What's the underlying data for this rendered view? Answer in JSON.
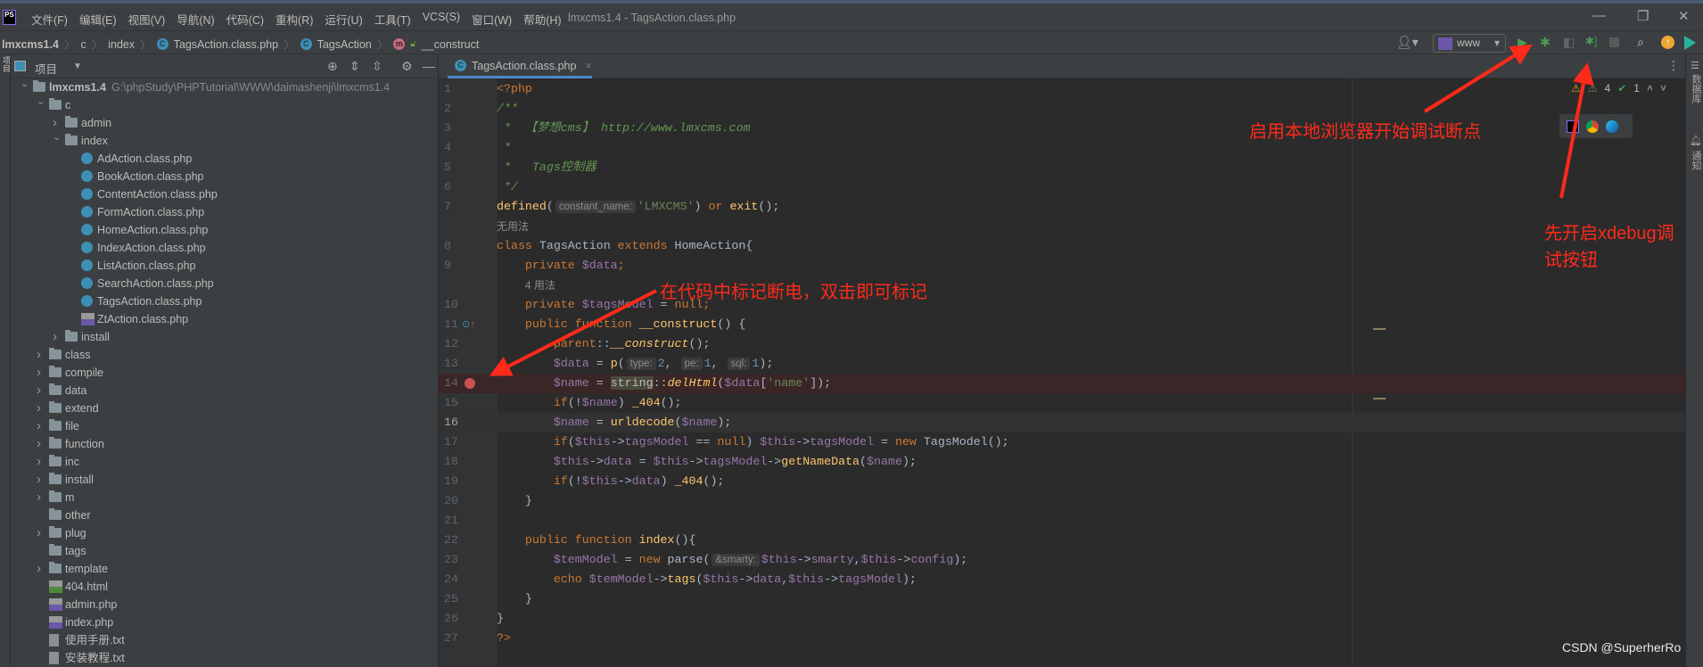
{
  "window": {
    "title": "lmxcms1.4 - TagsAction.class.php",
    "logo": "PS",
    "menu": [
      "文件(F)",
      "编辑(E)",
      "视图(V)",
      "导航(N)",
      "代码(C)",
      "重构(R)",
      "运行(U)",
      "工具(T)",
      "VCS(S)",
      "窗口(W)",
      "帮助(H)"
    ],
    "controls": {
      "minimize": "—",
      "restore": "❐",
      "close": "✕"
    }
  },
  "breadcrumb": [
    "lmxcms1.4",
    "c",
    "index",
    "TagsAction.class.php",
    "TagsAction",
    "__construct"
  ],
  "toolbar": {
    "run_config": "www",
    "icons": [
      "user-icon",
      "run-icon",
      "debug-icon",
      "coverage-icon",
      "listen-debug-connections-icon",
      "stop-icon",
      "search-icon",
      "update-icon",
      "toolbox-icon"
    ]
  },
  "project_panel": {
    "title": "项目",
    "tree": [
      {
        "depth": 0,
        "arrow": "open",
        "type": "folder",
        "label": "lmxcms1.4",
        "path": "G:\\phpStudy\\PHPTutorial\\WWW\\daimashenji\\lmxcms1.4",
        "bold": true
      },
      {
        "depth": 1,
        "arrow": "open",
        "type": "folder",
        "label": "c"
      },
      {
        "depth": 2,
        "arrow": "closed",
        "type": "folder",
        "label": "admin"
      },
      {
        "depth": 2,
        "arrow": "open",
        "type": "folder",
        "label": "index"
      },
      {
        "depth": 3,
        "type": "class",
        "label": "AdAction.class.php"
      },
      {
        "depth": 3,
        "type": "class",
        "label": "BookAction.class.php"
      },
      {
        "depth": 3,
        "type": "class",
        "label": "ContentAction.class.php"
      },
      {
        "depth": 3,
        "type": "class",
        "label": "FormAction.class.php"
      },
      {
        "depth": 3,
        "type": "class",
        "label": "HomeAction.class.php"
      },
      {
        "depth": 3,
        "type": "class",
        "label": "IndexAction.class.php"
      },
      {
        "depth": 3,
        "type": "class",
        "label": "ListAction.class.php"
      },
      {
        "depth": 3,
        "type": "class",
        "label": "SearchAction.class.php"
      },
      {
        "depth": 3,
        "type": "class",
        "label": "TagsAction.class.php"
      },
      {
        "depth": 3,
        "type": "php",
        "label": "ZtAction.class.php"
      },
      {
        "depth": 2,
        "arrow": "closed",
        "type": "folder",
        "label": "install"
      },
      {
        "depth": 1,
        "arrow": "closed",
        "type": "folder",
        "label": "class"
      },
      {
        "depth": 1,
        "arrow": "closed",
        "type": "folder",
        "label": "compile"
      },
      {
        "depth": 1,
        "arrow": "closed",
        "type": "folder",
        "label": "data"
      },
      {
        "depth": 1,
        "arrow": "closed",
        "type": "folder",
        "label": "extend"
      },
      {
        "depth": 1,
        "arrow": "closed",
        "type": "folder",
        "label": "file"
      },
      {
        "depth": 1,
        "arrow": "closed",
        "type": "folder",
        "label": "function"
      },
      {
        "depth": 1,
        "arrow": "closed",
        "type": "folder",
        "label": "inc"
      },
      {
        "depth": 1,
        "arrow": "closed",
        "type": "folder",
        "label": "install"
      },
      {
        "depth": 1,
        "arrow": "closed",
        "type": "folder",
        "label": "m"
      },
      {
        "depth": 1,
        "type": "folder",
        "label": "other"
      },
      {
        "depth": 1,
        "arrow": "closed",
        "type": "folder",
        "label": "plug"
      },
      {
        "depth": 1,
        "type": "folder",
        "label": "tags"
      },
      {
        "depth": 1,
        "arrow": "closed",
        "type": "folder",
        "label": "template"
      },
      {
        "depth": 1,
        "type": "html",
        "label": "404.html"
      },
      {
        "depth": 1,
        "type": "php",
        "label": "admin.php"
      },
      {
        "depth": 1,
        "type": "php",
        "label": "index.php"
      },
      {
        "depth": 1,
        "type": "txt",
        "label": "使用手册.txt"
      },
      {
        "depth": 1,
        "type": "txt",
        "label": "安装教程.txt"
      }
    ]
  },
  "editor": {
    "tab_label": "TagsAction.class.php",
    "inspections": {
      "warnings": "4",
      "ok": "1"
    },
    "breakpoint_line": 14,
    "current_line": 16,
    "lines": [
      {
        "num": "1",
        "t": [
          [
            "k",
            "<?php"
          ]
        ]
      },
      {
        "num": "2",
        "t": [
          [
            "c",
            "/**"
          ]
        ]
      },
      {
        "num": "3",
        "t": [
          [
            "c",
            " *  【梦想cms】 http://www.lmxcms.com"
          ]
        ]
      },
      {
        "num": "4",
        "t": [
          [
            "c",
            " *"
          ]
        ]
      },
      {
        "num": "5",
        "t": [
          [
            "c",
            " *   Tags控制器"
          ]
        ]
      },
      {
        "num": "6",
        "t": [
          [
            "c",
            " */"
          ]
        ]
      },
      {
        "num": "7",
        "t": [
          [
            "f",
            "defined"
          ],
          [
            "p",
            "("
          ],
          [
            "h",
            "constant_name:"
          ],
          [
            "s",
            "'LMXCMS'"
          ],
          [
            "p",
            ") "
          ],
          [
            "k",
            "or "
          ],
          [
            "f",
            "exit"
          ],
          [
            "p",
            "();"
          ]
        ]
      },
      {
        "num": "",
        "t": [
          [
            "lens",
            "无用法"
          ]
        ]
      },
      {
        "num": "8",
        "t": [
          [
            "k",
            "class "
          ],
          [
            "p",
            "TagsAction "
          ],
          [
            "k",
            "extends "
          ],
          [
            "p",
            "HomeAction{"
          ]
        ]
      },
      {
        "num": "9",
        "t": [
          [
            "p",
            "    "
          ],
          [
            "k",
            "private "
          ],
          [
            "v",
            "$data"
          ],
          [
            "k",
            ";"
          ]
        ]
      },
      {
        "num": "",
        "t": [
          [
            "p",
            "    "
          ],
          [
            "lens",
            "4 用法"
          ]
        ]
      },
      {
        "num": "10",
        "t": [
          [
            "p",
            "    "
          ],
          [
            "k",
            "private "
          ],
          [
            "v",
            "$tagsModel"
          ],
          [
            "p",
            " = "
          ],
          [
            "k",
            "null;"
          ]
        ]
      },
      {
        "num": "11",
        "t": [
          [
            "p",
            "    "
          ],
          [
            "k",
            "public function "
          ],
          [
            "f",
            "__construct"
          ],
          [
            "p",
            "() {"
          ]
        ]
      },
      {
        "num": "12",
        "t": [
          [
            "p",
            "        "
          ],
          [
            "k",
            "parent"
          ],
          [
            "p",
            "::"
          ],
          [
            "fi",
            "__construct"
          ],
          [
            "p",
            "();"
          ]
        ]
      },
      {
        "num": "13",
        "t": [
          [
            "p",
            "        "
          ],
          [
            "v",
            "$data"
          ],
          [
            "p",
            " = "
          ],
          [
            "f",
            "p"
          ],
          [
            "p",
            "("
          ],
          [
            "h",
            "type:"
          ],
          [
            "n",
            "2"
          ],
          [
            "p",
            ", "
          ],
          [
            "h",
            "pe:"
          ],
          [
            "n",
            "1"
          ],
          [
            "p",
            ", "
          ],
          [
            "h",
            "sql:"
          ],
          [
            "n",
            "1"
          ],
          [
            "p",
            ");"
          ]
        ]
      },
      {
        "num": "14",
        "t": [
          [
            "p",
            "        "
          ],
          [
            "v",
            "$name"
          ],
          [
            "p",
            " = "
          ],
          [
            "hl",
            "string"
          ],
          [
            "p",
            "::"
          ],
          [
            "fi",
            "delHtml"
          ],
          [
            "p",
            "("
          ],
          [
            "v",
            "$data"
          ],
          [
            "p",
            "["
          ],
          [
            "s",
            "'name'"
          ],
          [
            "p",
            "]);"
          ]
        ]
      },
      {
        "num": "15",
        "t": [
          [
            "p",
            "        "
          ],
          [
            "k",
            "if"
          ],
          [
            "p",
            "(!"
          ],
          [
            "v",
            "$name"
          ],
          [
            "p",
            ") "
          ],
          [
            "f",
            "_404"
          ],
          [
            "p",
            "();"
          ]
        ]
      },
      {
        "num": "16",
        "t": [
          [
            "p",
            "        "
          ],
          [
            "v",
            "$name"
          ],
          [
            "p",
            " = "
          ],
          [
            "f",
            "urldecode"
          ],
          [
            "p",
            "("
          ],
          [
            "v",
            "$name"
          ],
          [
            "p",
            ");"
          ]
        ]
      },
      {
        "num": "17",
        "t": [
          [
            "p",
            "        "
          ],
          [
            "k",
            "if"
          ],
          [
            "p",
            "("
          ],
          [
            "v",
            "$this"
          ],
          [
            "p",
            "->"
          ],
          [
            "v",
            "tagsModel"
          ],
          [
            "p",
            " == "
          ],
          [
            "k",
            "null"
          ],
          [
            "p",
            ") "
          ],
          [
            "v",
            "$this"
          ],
          [
            "p",
            "->"
          ],
          [
            "v",
            "tagsModel"
          ],
          [
            "p",
            " = "
          ],
          [
            "k",
            "new "
          ],
          [
            "p",
            "TagsModel();"
          ]
        ]
      },
      {
        "num": "18",
        "t": [
          [
            "p",
            "        "
          ],
          [
            "v",
            "$this"
          ],
          [
            "p",
            "->"
          ],
          [
            "v",
            "data"
          ],
          [
            "p",
            " = "
          ],
          [
            "v",
            "$this"
          ],
          [
            "p",
            "->"
          ],
          [
            "v",
            "tagsModel"
          ],
          [
            "p",
            "->"
          ],
          [
            "f",
            "getNameData"
          ],
          [
            "p",
            "("
          ],
          [
            "v",
            "$name"
          ],
          [
            "p",
            ");"
          ]
        ]
      },
      {
        "num": "19",
        "t": [
          [
            "p",
            "        "
          ],
          [
            "k",
            "if"
          ],
          [
            "p",
            "(!"
          ],
          [
            "v",
            "$this"
          ],
          [
            "p",
            "->"
          ],
          [
            "v",
            "data"
          ],
          [
            "p",
            ") "
          ],
          [
            "f",
            "_404"
          ],
          [
            "p",
            "();"
          ]
        ]
      },
      {
        "num": "20",
        "t": [
          [
            "p",
            "    }"
          ]
        ]
      },
      {
        "num": "21",
        "t": []
      },
      {
        "num": "22",
        "t": [
          [
            "p",
            "    "
          ],
          [
            "k",
            "public function "
          ],
          [
            "f",
            "index"
          ],
          [
            "p",
            "(){"
          ]
        ]
      },
      {
        "num": "23",
        "t": [
          [
            "p",
            "        "
          ],
          [
            "v",
            "$temModel"
          ],
          [
            "p",
            " = "
          ],
          [
            "k",
            "new "
          ],
          [
            "p",
            "parse("
          ],
          [
            "h",
            "&smarty:"
          ],
          [
            "v",
            "$this"
          ],
          [
            "p",
            "->"
          ],
          [
            "v",
            "smarty"
          ],
          [
            "p",
            ","
          ],
          [
            "v",
            "$this"
          ],
          [
            "p",
            "->"
          ],
          [
            "v",
            "config"
          ],
          [
            "p",
            ");"
          ]
        ]
      },
      {
        "num": "24",
        "t": [
          [
            "p",
            "        "
          ],
          [
            "k",
            "echo "
          ],
          [
            "v",
            "$temModel"
          ],
          [
            "p",
            "->"
          ],
          [
            "f",
            "tags"
          ],
          [
            "p",
            "("
          ],
          [
            "v",
            "$this"
          ],
          [
            "p",
            "->"
          ],
          [
            "v",
            "data"
          ],
          [
            "p",
            ","
          ],
          [
            "v",
            "$this"
          ],
          [
            "p",
            "->"
          ],
          [
            "v",
            "tagsModel"
          ],
          [
            "p",
            ");"
          ]
        ]
      },
      {
        "num": "25",
        "t": [
          [
            "p",
            "    }"
          ]
        ]
      },
      {
        "num": "26",
        "t": [
          [
            "p",
            "}"
          ]
        ]
      },
      {
        "num": "27",
        "t": [
          [
            "k",
            "?>"
          ]
        ]
      }
    ]
  },
  "right_strip": {
    "database": "数据库",
    "notifications": "通知"
  },
  "annotations": {
    "browser_debug": "启用本地浏览器开始调试断点",
    "xdebug_line1": "先开启xdebug调",
    "xdebug_line2": "试按钮",
    "breakpoint_hint": "在代码中标记断电，双击即可标记",
    "color": "#ff2a1a"
  },
  "watermark": "CSDN @SuperherRo",
  "colors": {
    "keyword": "#cc7832",
    "variable": "#9876aa",
    "string": "#6a8759",
    "function": "#ffc66d",
    "comment": "#629755",
    "breakpoint": "#c75450",
    "accent": "#4a88c7"
  }
}
